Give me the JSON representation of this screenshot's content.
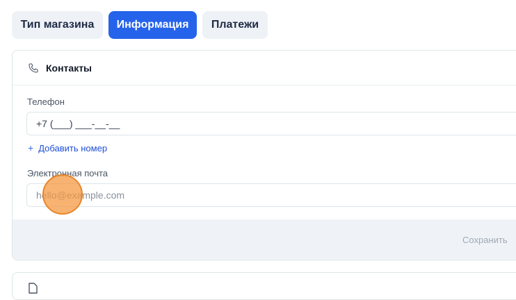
{
  "tabs": [
    {
      "label": "Тип магазина",
      "active": false
    },
    {
      "label": "Информация",
      "active": true
    },
    {
      "label": "Платежи",
      "active": false
    }
  ],
  "contacts": {
    "icon": "phone-icon",
    "title": "Контакты",
    "phone_label": "Телефон",
    "phone_value": "+7 (___) ___-__-__",
    "add_number": "Добавить номер",
    "email_label": "Электронная почта",
    "email_placeholder": "hello@example.com",
    "save_label": "Сохранить"
  },
  "next_section": {
    "icon": "document-icon"
  },
  "colors": {
    "accent": "#2563eb",
    "cursor": "#f59a3c"
  }
}
